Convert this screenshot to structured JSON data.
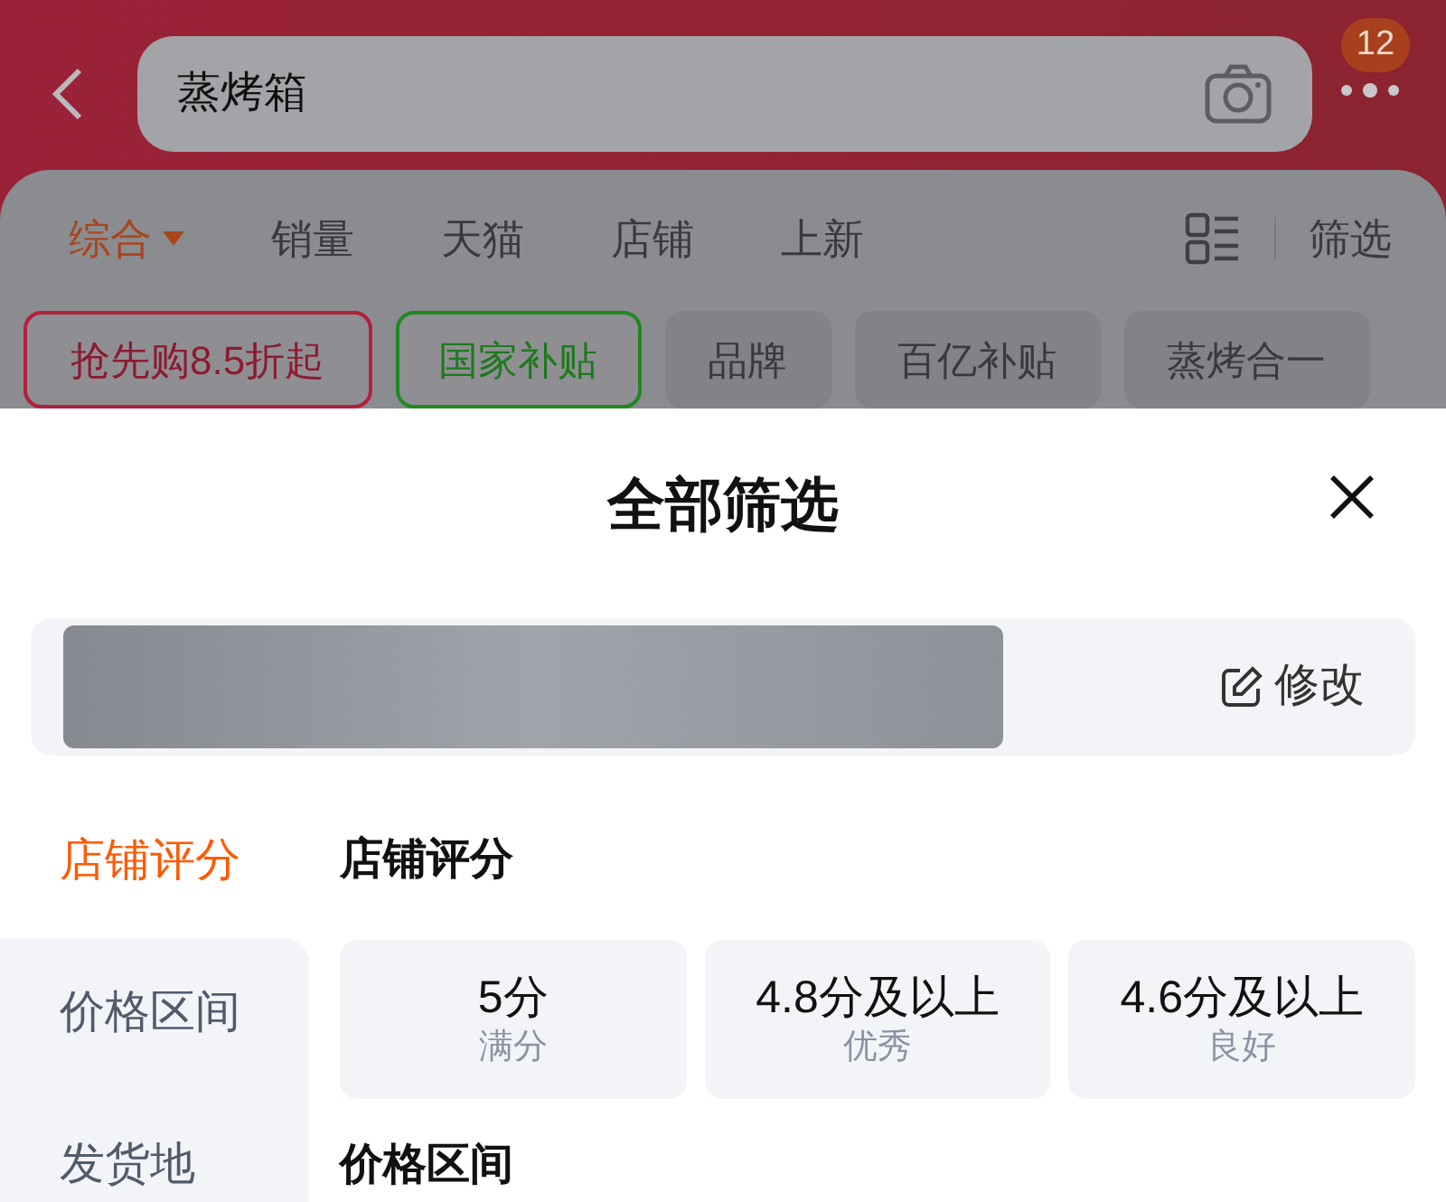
{
  "search": {
    "value": "蒸烤箱"
  },
  "message_badge": "12",
  "sort_tabs": [
    {
      "label": "综合",
      "selected": true,
      "dropdown": true
    },
    {
      "label": "销量",
      "selected": false,
      "dropdown": false
    },
    {
      "label": "天猫",
      "selected": false,
      "dropdown": false
    },
    {
      "label": "店铺",
      "selected": false,
      "dropdown": false
    },
    {
      "label": "上新",
      "selected": false,
      "dropdown": false
    }
  ],
  "filter_button": "筛选",
  "chips": [
    {
      "label": "抢先购8.5折起",
      "kind": "promo"
    },
    {
      "label": "国家补贴",
      "kind": "subsidy"
    },
    {
      "label": "品牌",
      "kind": "plain"
    },
    {
      "label": "百亿补贴",
      "kind": "plain"
    },
    {
      "label": "蒸烤合一",
      "kind": "plain"
    }
  ],
  "sheet": {
    "title": "全部筛选",
    "address": {
      "edit_label": "修改"
    },
    "nav": [
      {
        "label": "店铺评分",
        "selected": true
      },
      {
        "label": "价格区间",
        "selected": false
      },
      {
        "label": "发货地",
        "selected": false
      }
    ],
    "sections": [
      {
        "title": "店铺评分",
        "options": [
          {
            "label": "5分",
            "sub": "满分",
            "selected": false
          },
          {
            "label": "4.8分及以上",
            "sub": "优秀",
            "selected": false
          },
          {
            "label": "4.6分及以上",
            "sub": "良好",
            "selected": false
          }
        ]
      },
      {
        "title": "价格区间"
      }
    ]
  }
}
